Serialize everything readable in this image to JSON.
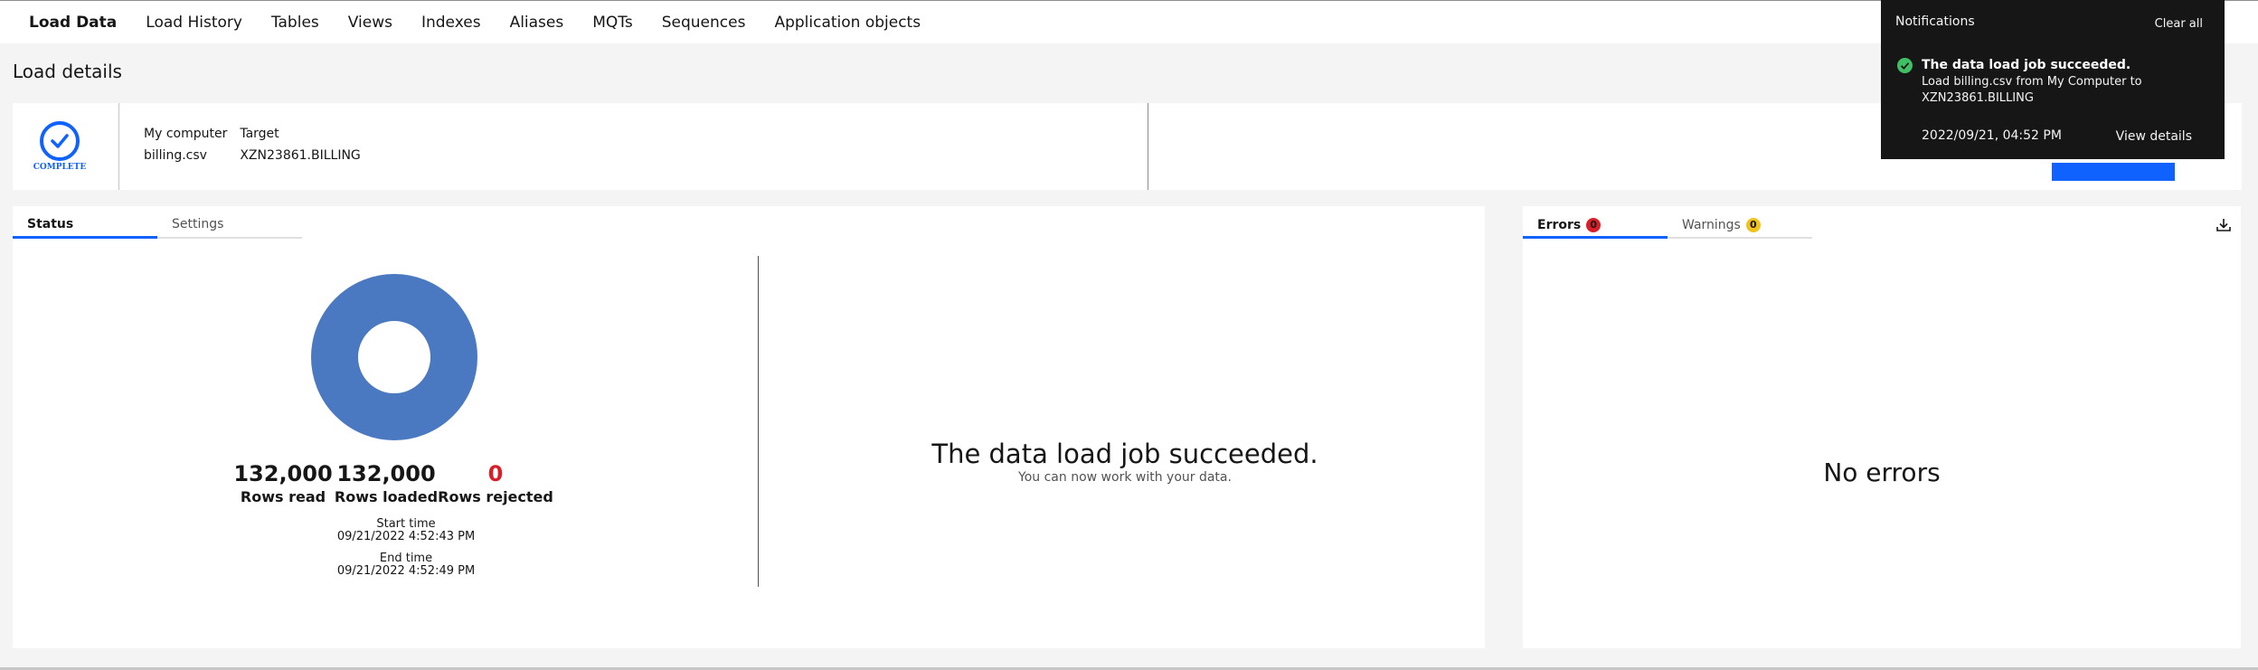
{
  "nav": {
    "items": [
      "Load Data",
      "Load History",
      "Tables",
      "Views",
      "Indexes",
      "Aliases",
      "MQTs",
      "Sequences",
      "Application objects"
    ],
    "active": "Load Data"
  },
  "page_title": "Load details",
  "summary": {
    "badge_text": "COMPLETE",
    "badge_icon": "checkmark-icon",
    "source_header": "My computer",
    "target_header": "Target",
    "source_value": "billing.csv",
    "target_value": "XZN23861.BILLING"
  },
  "status_panel": {
    "tabs": [
      "Status",
      "Settings"
    ],
    "active_tab": "Status",
    "rows_read_value": "132,000",
    "rows_read_label": "Rows read",
    "rows_loaded_value": "132,000",
    "rows_loaded_label": "Rows loaded",
    "rows_rejected_value": "0",
    "rows_rejected_label": "Rows rejected",
    "start_time_label": "Start time",
    "start_time_value": "09/21/2022 4:52:43 PM",
    "end_time_label": "End time",
    "end_time_value": "09/21/2022 4:52:49 PM",
    "success_title": "The data load job succeeded.",
    "success_subtitle": "You can now work with your data.",
    "donut_color": "#4a78c1",
    "loaded_fraction": 1.0
  },
  "errors_panel": {
    "errors_label": "Errors",
    "errors_count": "0",
    "warnings_label": "Warnings",
    "warnings_count": "0",
    "empty_message": "No errors",
    "download_icon": "download-icon"
  },
  "notification": {
    "header": "Notifications",
    "clear_all": "Clear all",
    "title": "The data load job succeeded.",
    "message": "Load billing.csv from My Computer to XZN23861.BILLING",
    "timestamp": "2022/09/21, 04:52 PM",
    "action": "View details",
    "status_icon": "success-check-icon",
    "status_color": "#42be65"
  },
  "colors": {
    "accent": "#0f62fe",
    "error": "#da1e28",
    "warning": "#f1c21b"
  }
}
